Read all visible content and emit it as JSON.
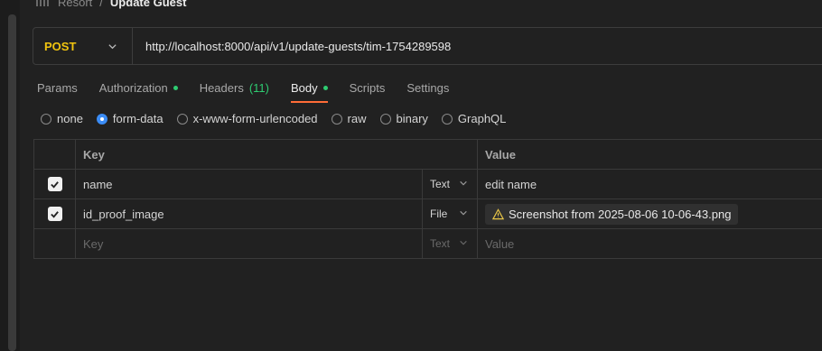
{
  "breadcrumb": {
    "parent": "Resort",
    "separator": "/",
    "current": "Update Guest"
  },
  "request": {
    "method": "POST",
    "url": "http://localhost:8000/api/v1/update-guests/tim-1754289598"
  },
  "tabs": [
    {
      "label": "Params"
    },
    {
      "label": "Authorization"
    },
    {
      "label": "Headers",
      "count": "(11)"
    },
    {
      "label": "Body"
    },
    {
      "label": "Scripts"
    },
    {
      "label": "Settings"
    }
  ],
  "body_types": [
    "none",
    "form-data",
    "x-www-form-urlencoded",
    "raw",
    "binary",
    "GraphQL"
  ],
  "table": {
    "headers": {
      "key": "Key",
      "value": "Value"
    },
    "rows": [
      {
        "key": "name",
        "type": "Text",
        "value": "edit name"
      },
      {
        "key": "id_proof_image",
        "type": "File",
        "value": "Screenshot from 2025-08-06 10-06-43.png"
      }
    ],
    "empty_row": {
      "key": "Key",
      "type": "Text",
      "value": "Value"
    }
  },
  "colors": {
    "method": "#f1c40f",
    "active_tab_underline": "#ff6c37",
    "status_dot": "#2ecc71",
    "radio_selected": "#3b8cf5"
  }
}
